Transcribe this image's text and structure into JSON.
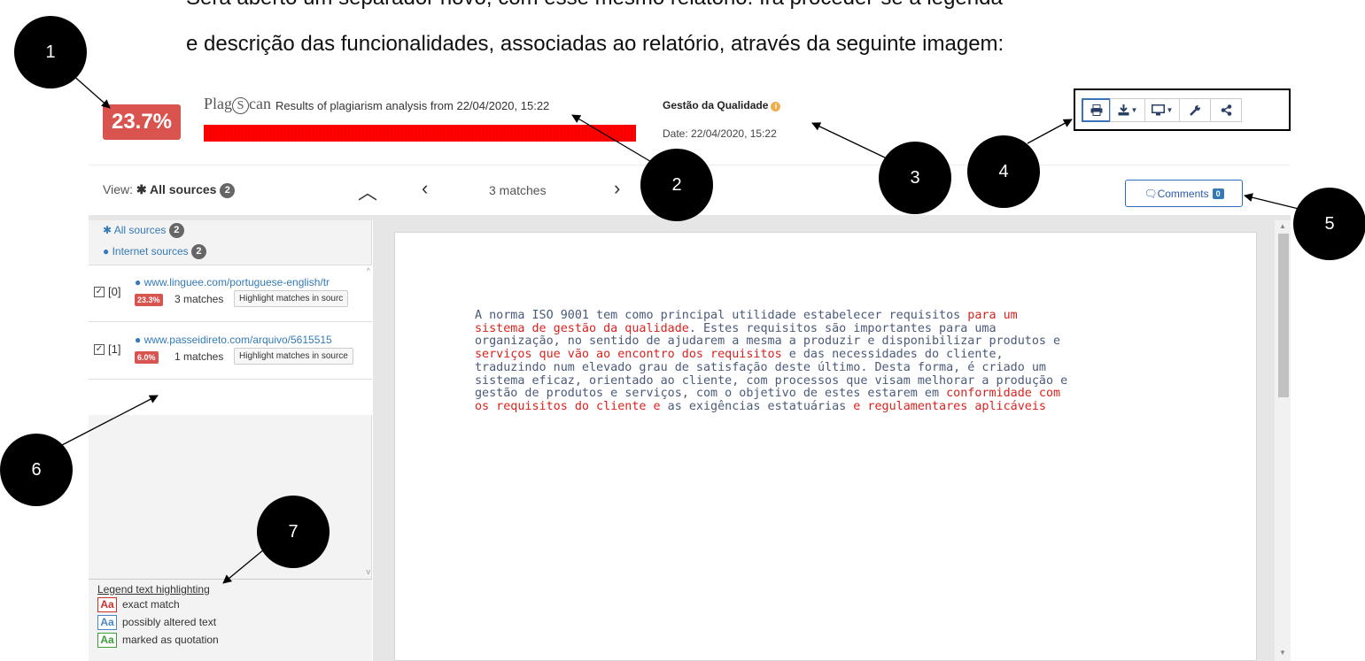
{
  "doc": {
    "line1": "Será aberto um separador novo, com esse mesmo relatório. Irá proceder-se à legenda",
    "line2": "e descrição das funcionalidades, associadas ao relatório, através da seguinte imagem:"
  },
  "callouts": [
    "1",
    "2",
    "3",
    "4",
    "5",
    "6",
    "7"
  ],
  "report": {
    "score": "23.7%",
    "brand": {
      "left": "Plag",
      "circle": "S",
      "right": "can"
    },
    "results_title": "Results of plagiarism analysis from 22/04/2020, 15:22",
    "document_name": "Gestão da Qualidade",
    "info_icon": "i",
    "date": "Date: 22/04/2020, 15:22"
  },
  "toolbar": {
    "icons": [
      "print-icon",
      "download-icon",
      "display-icon",
      "wrench-icon",
      "share-icon"
    ]
  },
  "view": {
    "label": "View:",
    "selected": "All sources",
    "count": "2",
    "matches": "3 matches"
  },
  "comments": {
    "label": "Comments",
    "count": "0"
  },
  "sidebar": {
    "filters": [
      {
        "label": "All sources",
        "count": "2"
      },
      {
        "label": "Internet sources",
        "count": "2"
      }
    ],
    "sources": [
      {
        "index": "[0]",
        "url": "www.linguee.com/portuguese-english/tr",
        "pct": "23.3%",
        "matches": "3 matches",
        "button": "Highlight matches in sourc"
      },
      {
        "index": "[1]",
        "url": "www.passeidireto.com/arquivo/5615515",
        "pct": "6.0%",
        "matches": "1 matches",
        "button": "Highlight matches in source"
      }
    ]
  },
  "legend": {
    "title": "Legend text highlighting",
    "items": [
      {
        "glyph": "Aa",
        "label": "exact match",
        "color": "#c9302c"
      },
      {
        "glyph": "Aa",
        "label": "possibly altered text",
        "color": "#4a86c5"
      },
      {
        "glyph": "Aa",
        "label": "marked as quotation",
        "color": "#3a9d3a"
      }
    ]
  },
  "document_text": [
    [
      {
        "t": "A norma ISO 9001 tem como principal utilidade estabelecer requisitos ",
        "m": false
      },
      {
        "t": "para um",
        "m": true
      }
    ],
    [
      {
        "t": "sistema de gestão da qualidade",
        "m": true
      },
      {
        "t": ". Estes requisitos são importantes para uma",
        "m": false
      }
    ],
    [
      {
        "t": "organização, no sentido de ajudarem a mesma a produzir e disponibilizar produtos e",
        "m": false
      }
    ],
    [
      {
        "t": "serviços que vão ao encontro dos requisitos",
        "m": true
      },
      {
        "t": " e das necessidades do cliente,",
        "m": false
      }
    ],
    [
      {
        "t": "traduzindo num elevado grau de satisfação deste último. Desta forma, é criado um",
        "m": false
      }
    ],
    [
      {
        "t": "sistema eficaz, orientado ao cliente, com processos que visam melhorar a produção e",
        "m": false
      }
    ],
    [
      {
        "t": "gestão de produtos e serviços, com o objetivo de estes estarem em ",
        "m": false
      },
      {
        "t": "conformidade com",
        "m": true
      }
    ],
    [
      {
        "t": "os requisitos do cliente e",
        "m": true
      },
      {
        "t": " as exigências estatuárias ",
        "m": false
      },
      {
        "t": "e regulamentares aplicáveis",
        "m": true
      }
    ]
  ],
  "colors": {
    "score_red": "#d9534f",
    "match_red": "#d9231f",
    "link_blue": "#337ab7"
  }
}
